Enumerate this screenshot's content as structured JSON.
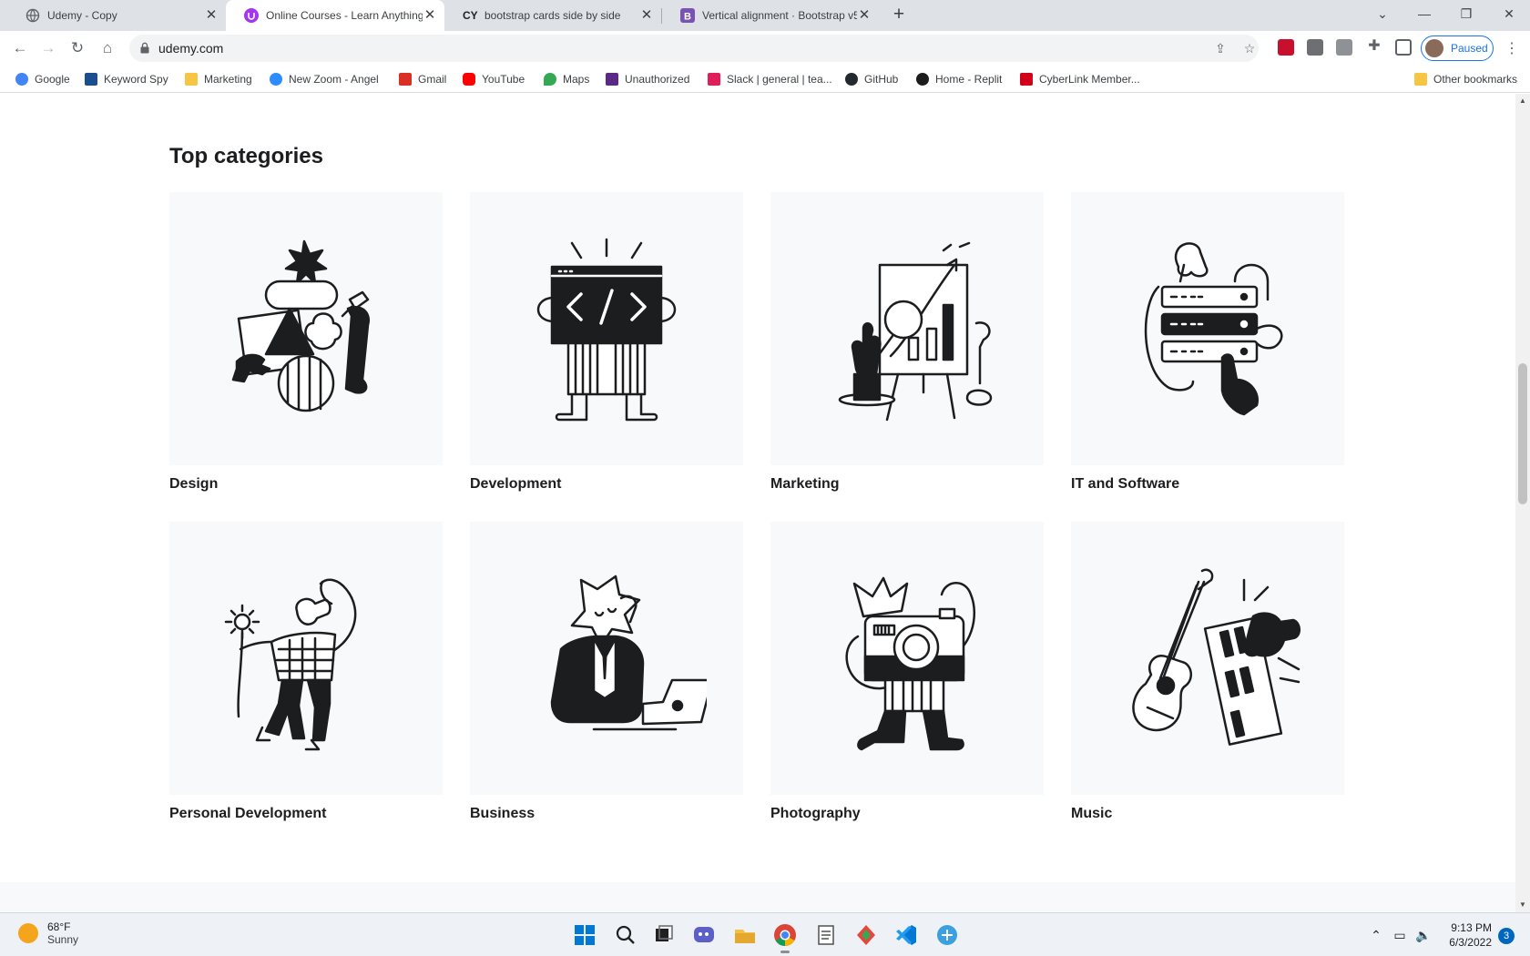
{
  "browser": {
    "tabs": [
      {
        "title": "Udemy - Copy",
        "active": false
      },
      {
        "title": "Online Courses - Learn Anything",
        "active": true
      },
      {
        "title": "bootstrap cards side by side",
        "active": false
      },
      {
        "title": "Vertical alignment · Bootstrap v5",
        "active": false
      }
    ],
    "url": "udemy.com",
    "profile_label": "Paused"
  },
  "bookmarks": [
    {
      "label": "Google",
      "icon": "google-icon",
      "color": "#4285f4"
    },
    {
      "label": "Keyword Spy",
      "icon": "keyword-spy-icon",
      "color": "#1b4e8f"
    },
    {
      "label": "Marketing",
      "icon": "folder-icon",
      "color": "#f6c544"
    },
    {
      "label": "New Zoom - Angel",
      "icon": "zoom-icon",
      "color": "#2d8cff"
    },
    {
      "label": "Gmail",
      "icon": "gmail-icon",
      "color": "#d93025"
    },
    {
      "label": "YouTube",
      "icon": "youtube-icon",
      "color": "#ff0000"
    },
    {
      "label": "Maps",
      "icon": "maps-icon",
      "color": "#34a853"
    },
    {
      "label": "Unauthorized",
      "icon": "unauthorized-icon",
      "color": "#5b2a86"
    },
    {
      "label": "Slack | general | tea...",
      "icon": "slack-icon",
      "color": "#e01e5a"
    },
    {
      "label": "GitHub",
      "icon": "github-icon",
      "color": "#24292e"
    },
    {
      "label": "Home - Replit",
      "icon": "replit-icon",
      "color": "#1c1c1c"
    },
    {
      "label": "CyberLink Member...",
      "icon": "cyberlink-icon",
      "color": "#d0021b"
    }
  ],
  "other_bookmarks": "Other bookmarks",
  "page": {
    "section_title": "Top categories",
    "categories": [
      {
        "label": "Design",
        "icon": "design-illustration"
      },
      {
        "label": "Development",
        "icon": "development-illustration"
      },
      {
        "label": "Marketing",
        "icon": "marketing-illustration"
      },
      {
        "label": "IT and Software",
        "icon": "it-software-illustration"
      },
      {
        "label": "Personal Development",
        "icon": "personal-development-illustration"
      },
      {
        "label": "Business",
        "icon": "business-illustration"
      },
      {
        "label": "Photography",
        "icon": "photography-illustration"
      },
      {
        "label": "Music",
        "icon": "music-illustration"
      }
    ]
  },
  "taskbar": {
    "weather_temp": "68°F",
    "weather_desc": "Sunny",
    "time": "9:13 PM",
    "date": "6/3/2022",
    "notification_count": "3"
  }
}
